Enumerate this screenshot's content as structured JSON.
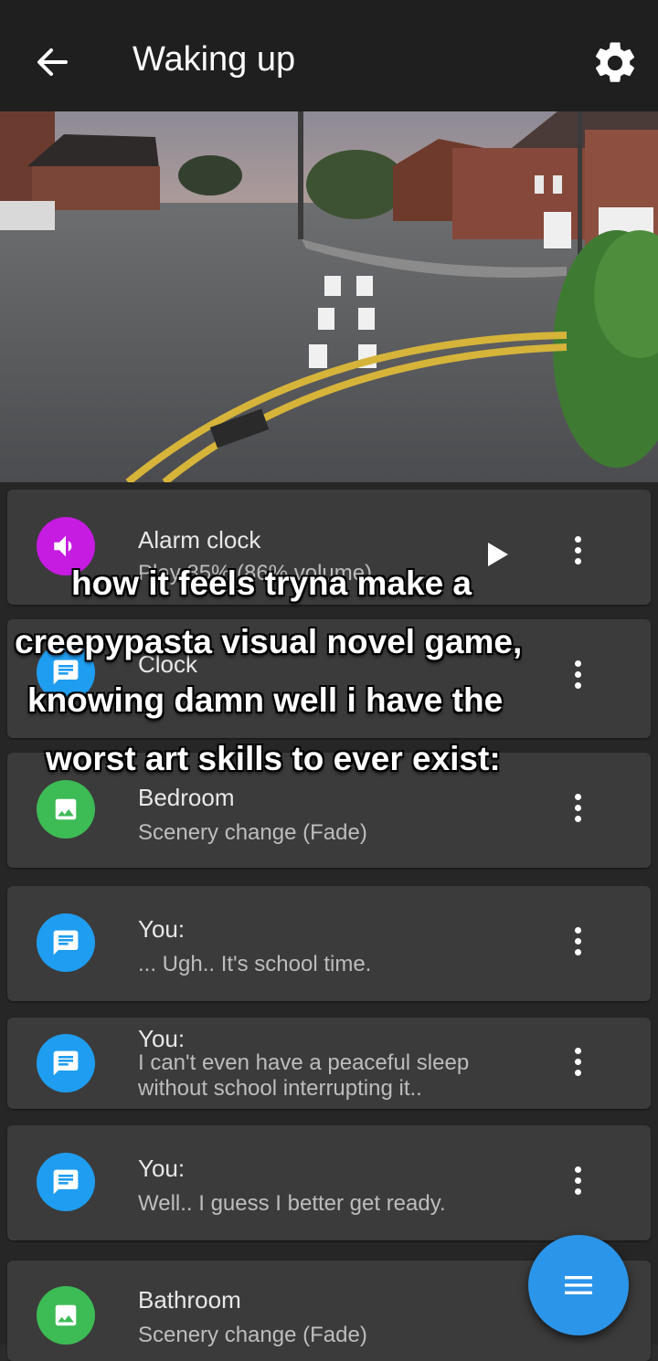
{
  "app_bar": {
    "title": "Waking up",
    "back_icon": "arrow-left-icon",
    "settings_icon": "gear-icon"
  },
  "overlay_caption": {
    "lines": [
      "how it feels tryna make a",
      "creepypasta visual novel game,",
      "knowing damn well i have the",
      "worst art skills to ever exist:"
    ]
  },
  "events": [
    {
      "type": "sound",
      "icon": "speaker-icon",
      "color": "#c61be0",
      "title": "Alarm clock",
      "subtitle": "Play 85% (86% volume)"
    },
    {
      "type": "dialog",
      "icon": "chat-icon",
      "color": "#1f9df0",
      "title": "Clock",
      "subtitle": ""
    },
    {
      "type": "scenery",
      "icon": "image-icon",
      "color": "#3dbb55",
      "title": "Bedroom",
      "subtitle": "Scenery change (Fade)"
    },
    {
      "type": "dialog",
      "icon": "chat-icon",
      "color": "#1f9df0",
      "title": "You:",
      "subtitle": "... Ugh.. It's school time."
    },
    {
      "type": "dialog",
      "icon": "chat-icon",
      "color": "#1f9df0",
      "title": "You:",
      "subtitle": "I can't even have a peaceful sleep without school interrupting it.."
    },
    {
      "type": "dialog",
      "icon": "chat-icon",
      "color": "#1f9df0",
      "title": "You:",
      "subtitle": "Well.. I guess I better get ready."
    },
    {
      "type": "scenery",
      "icon": "image-icon",
      "color": "#3dbb55",
      "title": "Bathroom",
      "subtitle": "Scenery change (Fade)"
    }
  ],
  "fab": {
    "icon": "menu-icon",
    "color": "#2b95e9"
  }
}
